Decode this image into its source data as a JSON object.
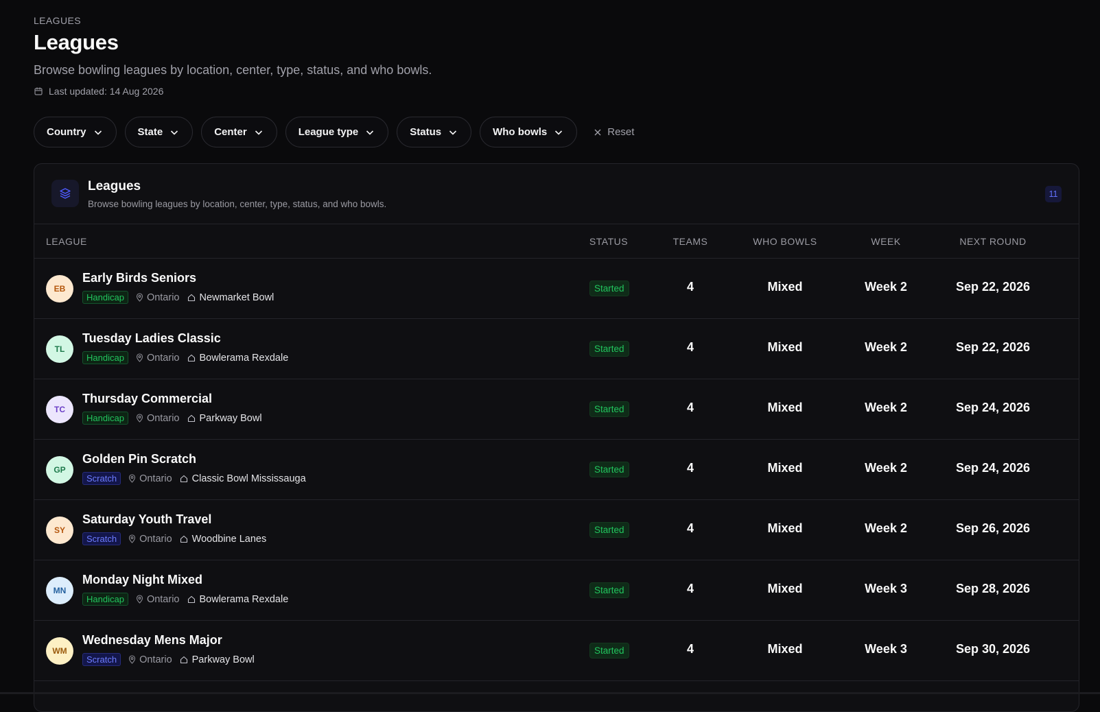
{
  "header": {
    "eyebrow": "LEAGUES",
    "title": "Leagues",
    "subtitle": "Browse bowling leagues by location, center, type, status, and who bowls.",
    "last_updated": "Last updated: 14 Aug 2026"
  },
  "filters": {
    "country": "Country",
    "state": "State",
    "center": "Center",
    "league_type": "League type",
    "status": "Status",
    "who_bowls": "Who bowls",
    "reset": "Reset"
  },
  "card": {
    "title": "Leagues",
    "subtitle": "Browse bowling leagues by location, center, type, status, and who bowls.",
    "count": "11"
  },
  "table": {
    "columns": {
      "league": "LEAGUE",
      "status": "STATUS",
      "teams": "TEAMS",
      "who_bowls": "WHO BOWLS",
      "week": "WEEK",
      "next_round": "NEXT ROUND"
    },
    "rows": [
      {
        "initials": "EB",
        "name": "Early Birds Seniors",
        "type": "Handicap",
        "region": "Ontario",
        "center": "Newmarket Bowl",
        "status": "Started",
        "teams": "4",
        "who_bowls": "Mixed",
        "week": "Week 2",
        "next_round": "Sep 22, 2026"
      },
      {
        "initials": "TL",
        "name": "Tuesday Ladies Classic",
        "type": "Handicap",
        "region": "Ontario",
        "center": "Bowlerama Rexdale",
        "status": "Started",
        "teams": "4",
        "who_bowls": "Mixed",
        "week": "Week 2",
        "next_round": "Sep 22, 2026"
      },
      {
        "initials": "TC",
        "name": "Thursday Commercial",
        "type": "Handicap",
        "region": "Ontario",
        "center": "Parkway Bowl",
        "status": "Started",
        "teams": "4",
        "who_bowls": "Mixed",
        "week": "Week 2",
        "next_round": "Sep 24, 2026"
      },
      {
        "initials": "GP",
        "name": "Golden Pin Scratch",
        "type": "Scratch",
        "region": "Ontario",
        "center": "Classic Bowl Mississauga",
        "status": "Started",
        "teams": "4",
        "who_bowls": "Mixed",
        "week": "Week 2",
        "next_round": "Sep 24, 2026"
      },
      {
        "initials": "SY",
        "name": "Saturday Youth Travel",
        "type": "Scratch",
        "region": "Ontario",
        "center": "Woodbine Lanes",
        "status": "Started",
        "teams": "4",
        "who_bowls": "Mixed",
        "week": "Week 2",
        "next_round": "Sep 26, 2026"
      },
      {
        "initials": "MN",
        "name": "Monday Night Mixed",
        "type": "Handicap",
        "region": "Ontario",
        "center": "Bowlerama Rexdale",
        "status": "Started",
        "teams": "4",
        "who_bowls": "Mixed",
        "week": "Week 3",
        "next_round": "Sep 28, 2026"
      },
      {
        "initials": "WM",
        "name": "Wednesday Mens Major",
        "type": "Scratch",
        "region": "Ontario",
        "center": "Parkway Bowl",
        "status": "Started",
        "teams": "4",
        "who_bowls": "Mixed",
        "week": "Week 3",
        "next_round": "Sep 30, 2026"
      }
    ]
  },
  "colors": {
    "background": "#0a0a0c",
    "card": "#0f0f12",
    "border": "#24242a",
    "status_green": "#22c55e",
    "scratch_blue": "#6d7cff",
    "accent_indigo": "#6272ff"
  },
  "icons": {
    "calendar": "calendar-icon",
    "chevron": "chevron-down-icon",
    "close": "close-icon",
    "layers": "layers-icon",
    "location": "map-pin-icon",
    "center": "home-icon"
  }
}
